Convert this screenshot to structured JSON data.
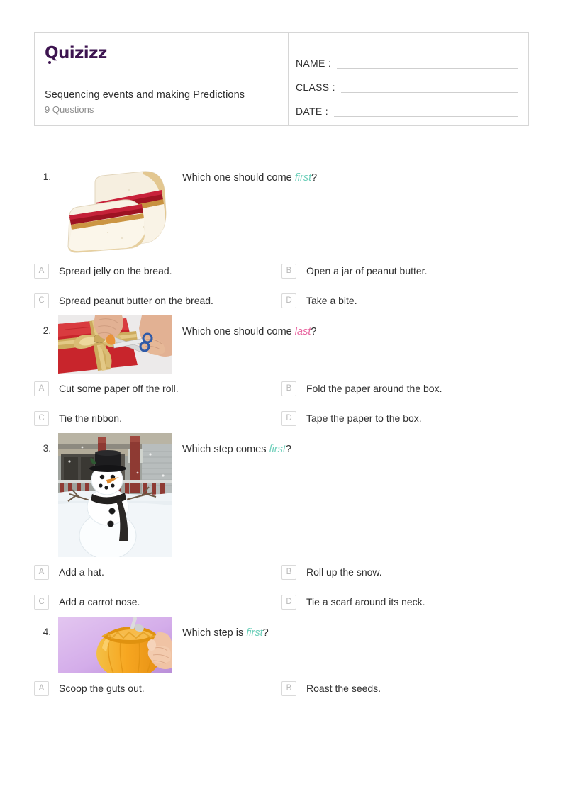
{
  "header": {
    "logo_text": "Quizizz",
    "logo_color": "#3d1450",
    "quiz_title": "Sequencing events and making Predictions",
    "question_count_label": "9 Questions",
    "fields": [
      {
        "label": "NAME :",
        "value": ""
      },
      {
        "label": "CLASS :",
        "value": ""
      },
      {
        "label": "DATE  :",
        "value": ""
      }
    ]
  },
  "style": {
    "keyword_first_color": "#6ecfba",
    "keyword_last_color": "#e8659f"
  },
  "questions": [
    {
      "number": "1.",
      "prompt_pre": "Which one should come ",
      "prompt_keyword": "first",
      "prompt_post": "?",
      "keyword_kind": "first",
      "image_name": "peanut-butter-jelly-sandwich-photo",
      "options": [
        {
          "letter": "A",
          "text": "Spread jelly on the bread."
        },
        {
          "letter": "B",
          "text": "Open a jar of peanut butter."
        },
        {
          "letter": "C",
          "text": "Spread peanut butter on the bread."
        },
        {
          "letter": "D",
          "text": "Take a bite."
        }
      ]
    },
    {
      "number": "2.",
      "prompt_pre": "Which one should come ",
      "prompt_keyword": "last",
      "prompt_post": "?",
      "keyword_kind": "last",
      "image_name": "wrapping-gift-with-ribbon-photo",
      "options": [
        {
          "letter": "A",
          "text": "Cut some paper off the roll."
        },
        {
          "letter": "B",
          "text": "Fold the paper around the box."
        },
        {
          "letter": "C",
          "text": "Tie the ribbon."
        },
        {
          "letter": "D",
          "text": "Tape the paper to the box."
        }
      ]
    },
    {
      "number": "3.",
      "prompt_pre": "Which step comes ",
      "prompt_keyword": "first",
      "prompt_post": "?",
      "keyword_kind": "first",
      "image_name": "snowman-in-snowy-yard-photo",
      "options": [
        {
          "letter": "A",
          "text": "Add a hat."
        },
        {
          "letter": "B",
          "text": "Roll up the snow."
        },
        {
          "letter": "C",
          "text": "Add a carrot nose."
        },
        {
          "letter": "D",
          "text": "Tie a scarf around its neck."
        }
      ]
    },
    {
      "number": "4.",
      "prompt_pre": "Which step is ",
      "prompt_keyword": "first",
      "prompt_post": "?",
      "keyword_kind": "first",
      "image_name": "carving-pumpkin-photo",
      "options": [
        {
          "letter": "A",
          "text": "Scoop the guts out."
        },
        {
          "letter": "B",
          "text": "Roast the seeds."
        }
      ]
    }
  ]
}
